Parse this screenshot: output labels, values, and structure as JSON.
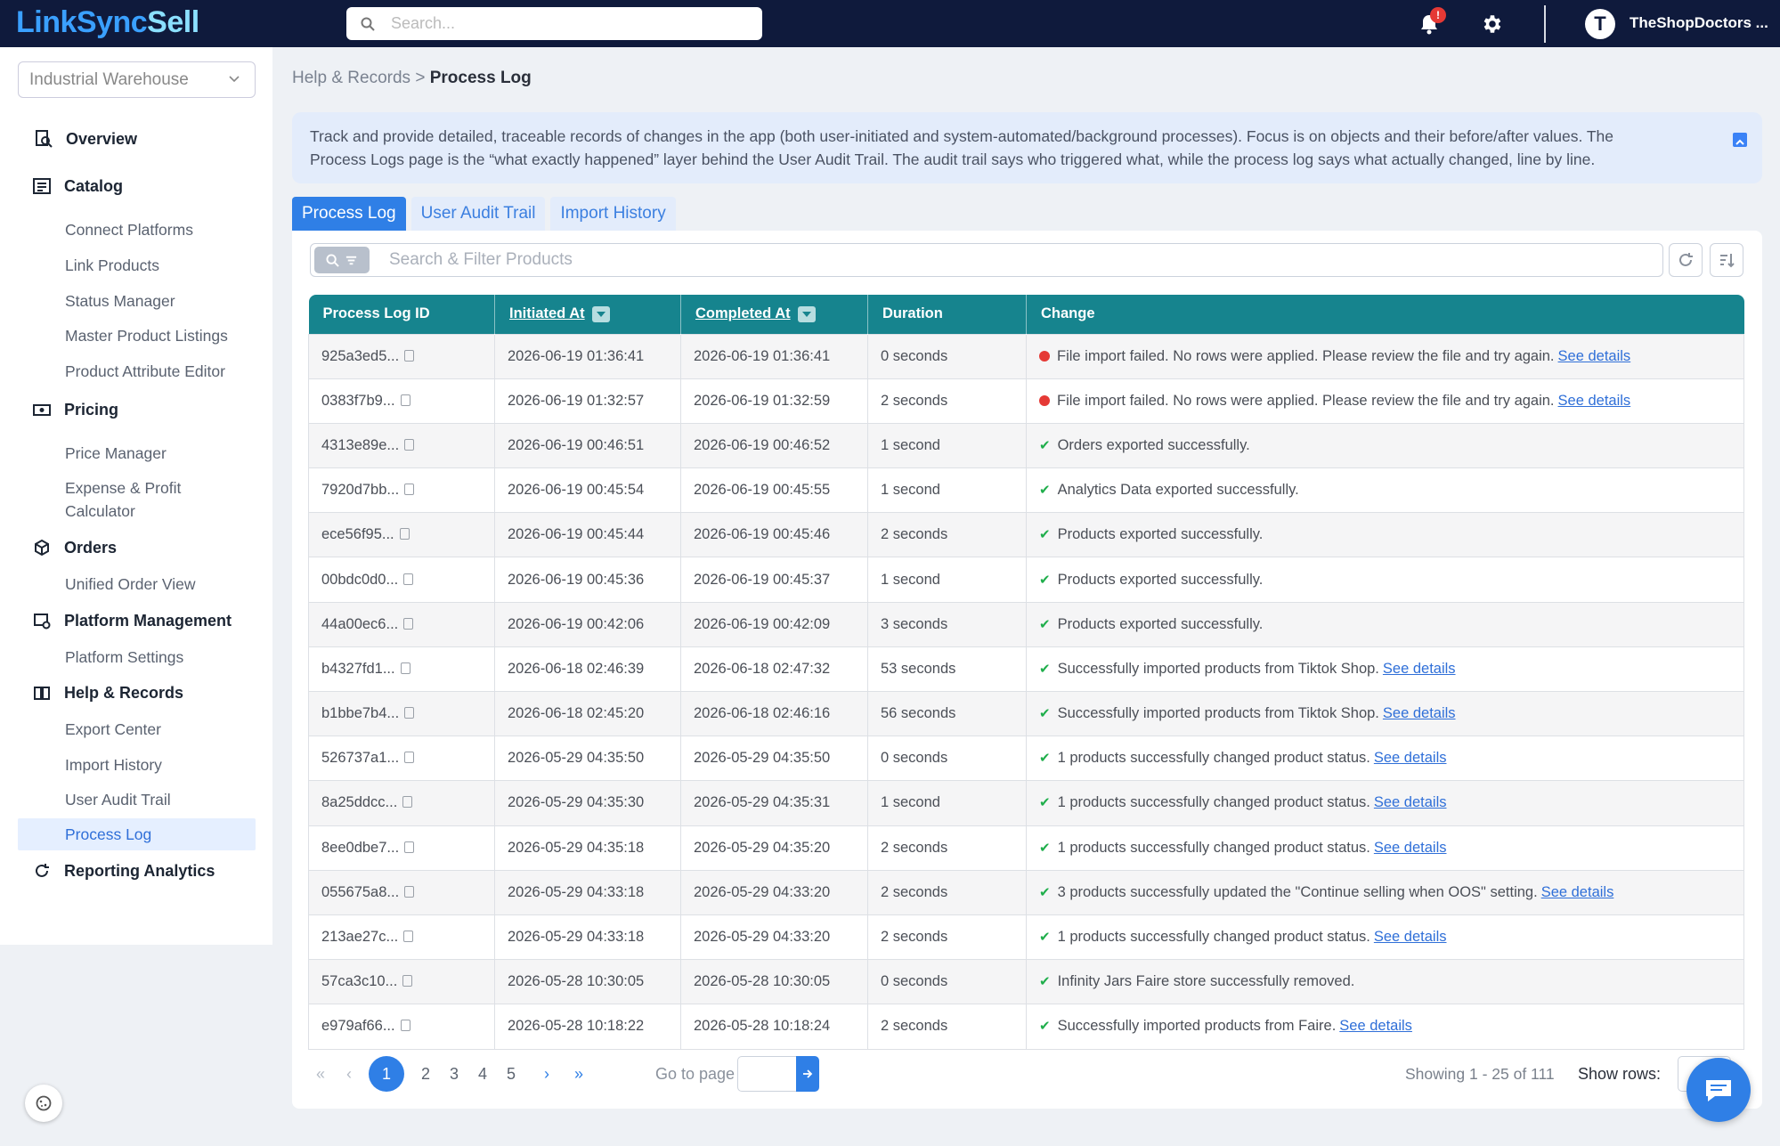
{
  "app": {
    "logo_part1": "LinkSync",
    "logo_part2": "Sell"
  },
  "topbar": {
    "search_placeholder": "Search...",
    "notification_badge": "!",
    "avatar_letter": "T",
    "username": "TheShopDoctors ..."
  },
  "sidebar": {
    "store": "Industrial Warehouse",
    "overview": "Overview",
    "catalog": "Catalog",
    "catalog_items": [
      "Connect Platforms",
      "Link Products",
      "Status Manager",
      "Master Product Listings",
      "Product Attribute Editor"
    ],
    "pricing": "Pricing",
    "pricing_items": [
      "Price Manager",
      "Expense & Profit",
      "Calculator"
    ],
    "orders": "Orders",
    "orders_items": [
      "Unified Order View"
    ],
    "platform_management": "Platform Management",
    "platform_items": [
      "Platform Settings"
    ],
    "help_records": "Help & Records",
    "help_items": [
      "Export Center",
      "Import History",
      "User Audit Trail",
      "Process Log"
    ],
    "reporting": "Reporting Analytics"
  },
  "breadcrumb": {
    "parent": "Help & Records",
    "sep": ">",
    "current": "Process Log"
  },
  "info": {
    "line1": "Track and provide detailed, traceable records of changes in the app (both user-initiated and system-automated/background processes). Focus is on objects and their before/after values. The",
    "line2": "Process Logs page is the “what exactly happened” layer behind the User Audit Trail. The audit trail says who triggered what, while the process log says what actually changed, line by line."
  },
  "tabs": [
    "Process Log",
    "User Audit Trail",
    "Import History"
  ],
  "filter": {
    "placeholder": "Search & Filter Products"
  },
  "table": {
    "headers": [
      "Process Log ID",
      "Initiated At",
      "Completed At",
      "Duration",
      "Change"
    ],
    "link_label": "See details",
    "rows": [
      {
        "id": "925a3ed5...",
        "init": "2026-06-19 01:36:41",
        "comp": "2026-06-19 01:36:41",
        "dur": "0 seconds",
        "status": "error",
        "change": "File import failed. No rows were applied. Please review the file and try again.",
        "link": true
      },
      {
        "id": "0383f7b9...",
        "init": "2026-06-19 01:32:57",
        "comp": "2026-06-19 01:32:59",
        "dur": "2 seconds",
        "status": "error",
        "change": "File import failed. No rows were applied. Please review the file and try again.",
        "link": true
      },
      {
        "id": "4313e89e...",
        "init": "2026-06-19 00:46:51",
        "comp": "2026-06-19 00:46:52",
        "dur": "1 second",
        "status": "ok",
        "change": "Orders exported successfully.",
        "link": false
      },
      {
        "id": "7920d7bb...",
        "init": "2026-06-19 00:45:54",
        "comp": "2026-06-19 00:45:55",
        "dur": "1 second",
        "status": "ok",
        "change": "Analytics Data exported successfully.",
        "link": false
      },
      {
        "id": "ece56f95...",
        "init": "2026-06-19 00:45:44",
        "comp": "2026-06-19 00:45:46",
        "dur": "2 seconds",
        "status": "ok",
        "change": "Products exported successfully.",
        "link": false
      },
      {
        "id": "00bdc0d0...",
        "init": "2026-06-19 00:45:36",
        "comp": "2026-06-19 00:45:37",
        "dur": "1 second",
        "status": "ok",
        "change": "Products exported successfully.",
        "link": false
      },
      {
        "id": "44a00ec6...",
        "init": "2026-06-19 00:42:06",
        "comp": "2026-06-19 00:42:09",
        "dur": "3 seconds",
        "status": "ok",
        "change": "Products exported successfully.",
        "link": false
      },
      {
        "id": "b4327fd1...",
        "init": "2026-06-18 02:46:39",
        "comp": "2026-06-18 02:47:32",
        "dur": "53 seconds",
        "status": "ok",
        "change": "Successfully imported products from Tiktok Shop.",
        "link": true
      },
      {
        "id": "b1bbe7b4...",
        "init": "2026-06-18 02:45:20",
        "comp": "2026-06-18 02:46:16",
        "dur": "56 seconds",
        "status": "ok",
        "change": "Successfully imported products from Tiktok Shop.",
        "link": true
      },
      {
        "id": "526737a1...",
        "init": "2026-05-29 04:35:50",
        "comp": "2026-05-29 04:35:50",
        "dur": "0 seconds",
        "status": "ok",
        "change": "1 products successfully changed product status.",
        "link": true
      },
      {
        "id": "8a25ddcc...",
        "init": "2026-05-29 04:35:30",
        "comp": "2026-05-29 04:35:31",
        "dur": "1 second",
        "status": "ok",
        "change": "1 products successfully changed product status.",
        "link": true
      },
      {
        "id": "8ee0dbe7...",
        "init": "2026-05-29 04:35:18",
        "comp": "2026-05-29 04:35:20",
        "dur": "2 seconds",
        "status": "ok",
        "change": "1 products successfully changed product status.",
        "link": true
      },
      {
        "id": "055675a8...",
        "init": "2026-05-29 04:33:18",
        "comp": "2026-05-29 04:33:20",
        "dur": "2 seconds",
        "status": "ok",
        "change": "3 products successfully updated the \"Continue selling when OOS\" setting.",
        "link": true
      },
      {
        "id": "213ae27c...",
        "init": "2026-05-29 04:33:18",
        "comp": "2026-05-29 04:33:20",
        "dur": "2 seconds",
        "status": "ok",
        "change": "1 products successfully changed product status.",
        "link": true
      },
      {
        "id": "57ca3c10...",
        "init": "2026-05-28 10:30:05",
        "comp": "2026-05-28 10:30:05",
        "dur": "0 seconds",
        "status": "ok",
        "change": "Infinity Jars Faire store successfully removed.",
        "link": false
      },
      {
        "id": "e979af66...",
        "init": "2026-05-28 10:18:22",
        "comp": "2026-05-28 10:18:24",
        "dur": "2 seconds",
        "status": "ok",
        "change": "Successfully imported products from Faire.",
        "link": true
      }
    ]
  },
  "pagination": {
    "first": "«",
    "prev": "‹",
    "pages": [
      "1",
      "2",
      "3",
      "4",
      "5"
    ],
    "next": "›",
    "last": "»",
    "current": "1",
    "goto_label": "Go to page",
    "showing": "Showing 1 - 25 of 111",
    "show_rows_label": "Show rows:"
  },
  "colors": {
    "topbar": "#0f1a3c",
    "accent": "#2f7fe6",
    "table_header": "#16848e",
    "ok": "#1fae4b",
    "error": "#e53935"
  }
}
